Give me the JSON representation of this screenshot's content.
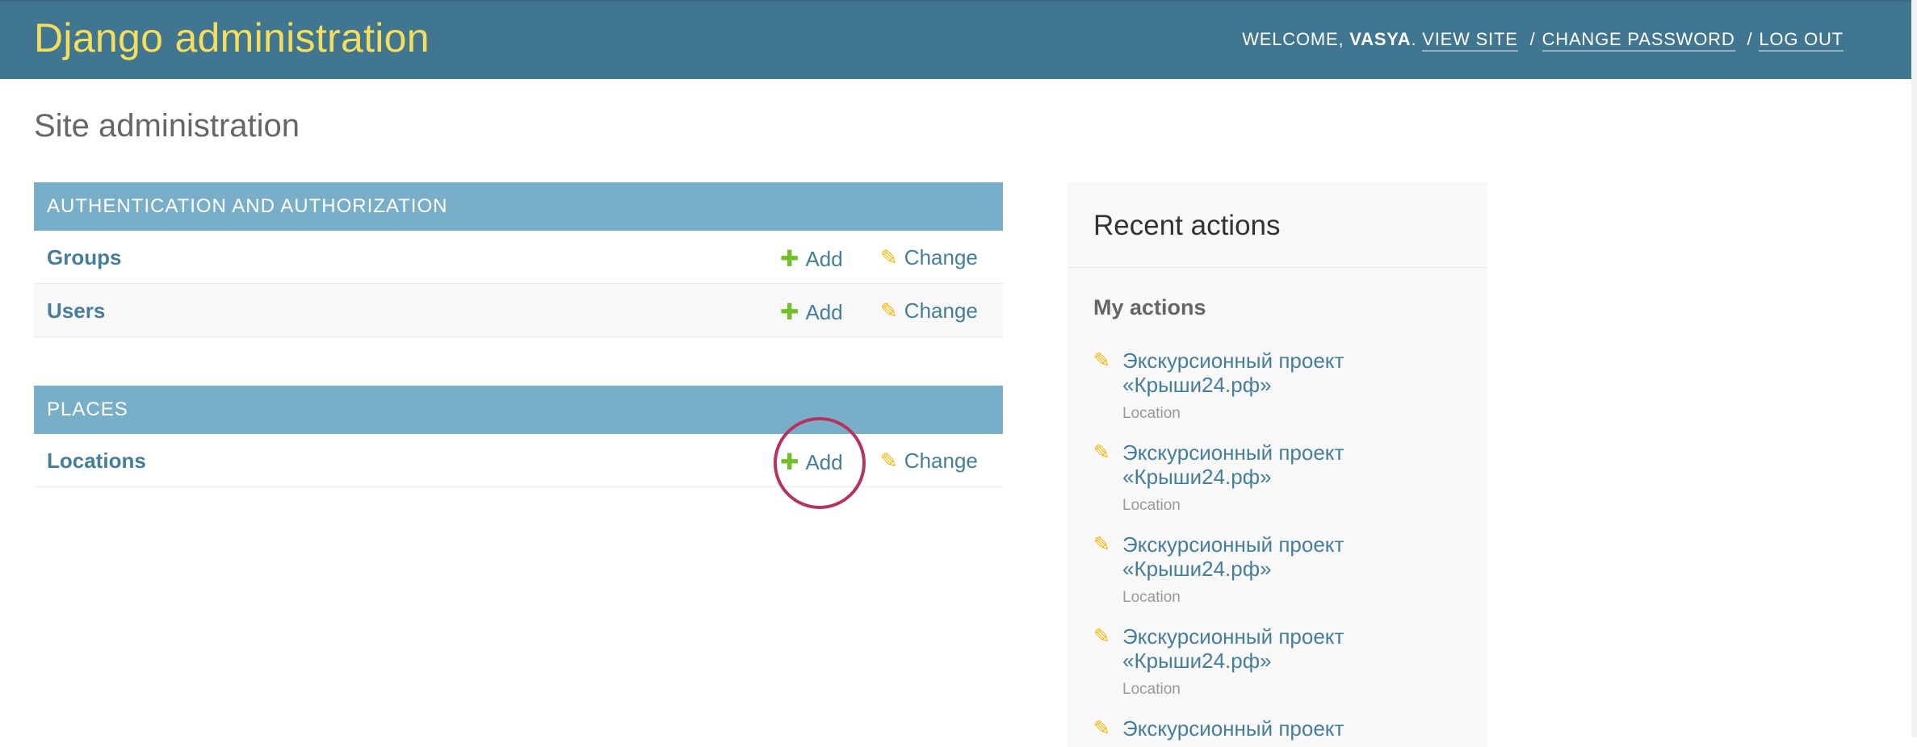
{
  "header": {
    "site_title": "Django administration",
    "welcome": "WELCOME,",
    "username": "VASYA",
    "username_suffix": ".",
    "view_site": "VIEW SITE",
    "change_password": "CHANGE PASSWORD",
    "log_out": "LOG OUT",
    "separator": "/"
  },
  "page_title": "Site administration",
  "modules": [
    {
      "caption": "AUTHENTICATION AND AUTHORIZATION",
      "rows": [
        {
          "label": "Groups",
          "add": "Add",
          "change": "Change"
        },
        {
          "label": "Users",
          "add": "Add",
          "change": "Change"
        }
      ]
    },
    {
      "caption": "PLACES",
      "rows": [
        {
          "label": "Locations",
          "add": "Add",
          "change": "Change"
        }
      ]
    }
  ],
  "icons": {
    "add_icon": "✚",
    "change_icon": "✎"
  },
  "recent_actions": {
    "title": "Recent actions",
    "subtitle": "My actions",
    "items": [
      {
        "text": "Экскурсионный проект «Крыши24.рф»",
        "type": "Location"
      },
      {
        "text": "Экскурсионный проект «Крыши24.рф»",
        "type": "Location"
      },
      {
        "text": "Экскурсионный проект «Крыши24.рф»",
        "type": "Location"
      },
      {
        "text": "Экскурсионный проект «Крыши24.рф»",
        "type": "Location"
      },
      {
        "text": "Экскурсионный проект",
        "type": ""
      }
    ]
  },
  "colors": {
    "header_bg": "#417690",
    "branding": "#f5dd5d",
    "caption_bg": "#79aec8",
    "link": "#447e9b",
    "add_icon": "#70bf2b",
    "change_icon": "#efb80b",
    "highlight": "#b5335f"
  }
}
